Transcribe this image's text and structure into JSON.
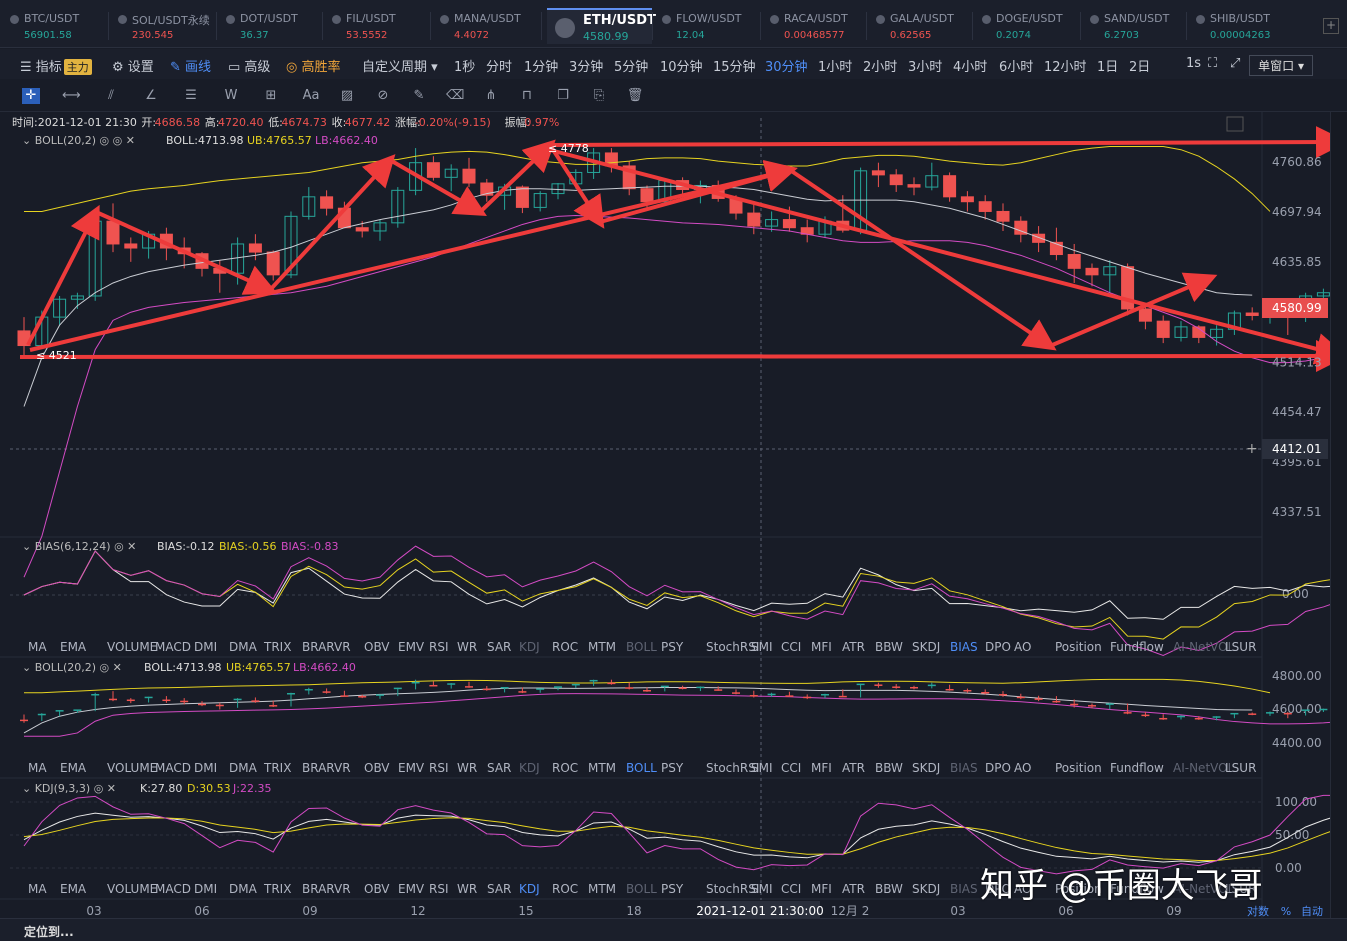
{
  "tabs": [
    {
      "name": "BTC/USDT",
      "price": "56901.58",
      "dir": "up"
    },
    {
      "name": "SOL/USDT永续",
      "price": "230.545",
      "dir": "dn"
    },
    {
      "name": "DOT/USDT",
      "price": "36.37",
      "dir": "up"
    },
    {
      "name": "FIL/USDT",
      "price": "53.5552",
      "dir": "dn"
    },
    {
      "name": "MANA/USDT",
      "price": "4.4072",
      "dir": "dn"
    },
    {
      "name": "ETH/USDT",
      "price": "4580.99",
      "dir": "up",
      "active": true
    },
    {
      "name": "FLOW/USDT",
      "price": "12.04",
      "dir": "up"
    },
    {
      "name": "RACA/USDT",
      "price": "0.00468577",
      "dir": "dn"
    },
    {
      "name": "GALA/USDT",
      "price": "0.62565",
      "dir": "dn"
    },
    {
      "name": "DOGE/USDT",
      "price": "0.2074",
      "dir": "up"
    },
    {
      "name": "SAND/USDT",
      "price": "6.2703",
      "dir": "up"
    },
    {
      "name": "SHIB/USDT",
      "price": "0.00004263",
      "dir": "up"
    }
  ],
  "toolbar": {
    "indicator": "指标",
    "main_badge": "主力",
    "settings": "设置",
    "draw": "画线",
    "advanced": "高级",
    "winrate": "高胜率",
    "custom_period": "自定义周期",
    "periods": [
      "1秒",
      "分时",
      "1分钟",
      "3分钟",
      "5分钟",
      "10分钟",
      "15分钟",
      "30分钟",
      "1小时",
      "2小时",
      "3小时",
      "4小时",
      "6小时",
      "12小时",
      "1日",
      "2日"
    ],
    "active_period": "30分钟",
    "interval": "1s",
    "single_window": "单窗口"
  },
  "colors": {
    "up": "#26a69a",
    "down": "#ef5350",
    "boll_mid": "#c9ccd3",
    "boll_ub": "#e6d320",
    "boll_lb": "#d34bc4",
    "blue": "#4f8ef7",
    "arrow": "#ee3b3b"
  },
  "info_line": {
    "time_label": "时间:",
    "time": "2021-12-01 21:30",
    "open_label": "开:",
    "open": "4686.58",
    "high_label": "高:",
    "high": "4720.40",
    "low_label": "低:",
    "low": "4674.73",
    "close_label": "收:",
    "close": "4677.42",
    "change_label": "涨幅:",
    "change": "-0.20%(-9.15)",
    "amp_label": "振幅:",
    "amp": "0.97%"
  },
  "boll_legend": {
    "name": "BOLL(20,2)",
    "mid": "BOLL:4713.98",
    "ub": "UB:4765.57",
    "lb": "LB:4662.40"
  },
  "bias_legend": {
    "name": "BIAS(6,12,24)",
    "b1": "BIAS:-0.12",
    "b2": "BIAS:-0.56",
    "b3": "BIAS:-0.83"
  },
  "kdj_legend": {
    "name": "KDJ(9,3,3)",
    "k": "K:27.80",
    "d": "D:30.53",
    "j": "J:22.35"
  },
  "indicator_tabs": [
    "MA",
    "EMA",
    "VOLUME",
    "MACD",
    "DMI",
    "DMA",
    "TRIX",
    "BRAR",
    "VR",
    "OBV",
    "EMV",
    "RSI",
    "WR",
    "SAR",
    "KDJ",
    "ROC",
    "MTM",
    "BOLL",
    "PSY",
    "StochRSI",
    "SMI",
    "CCI",
    "MFI",
    "ATR",
    "BBW",
    "SKDJ",
    "BIAS",
    "DPO",
    "AO",
    "Position",
    "Fundflow",
    "AI-NetVOL",
    "LSUR"
  ],
  "indicator_rows": [
    {
      "active": "BIAS",
      "dim": [
        "KDJ",
        "BOLL",
        "AI-NetVOL"
      ]
    },
    {
      "active": "BOLL",
      "dim": [
        "KDJ",
        "BIAS",
        "AI-NetVOL"
      ]
    },
    {
      "active": "KDJ",
      "dim": [
        "BOLL",
        "BIAS",
        "AI-NetVOL"
      ]
    }
  ],
  "main_axis": {
    "ticks": [
      "4760.86",
      "4697.94",
      "4635.85",
      "4514.13",
      "4454.47",
      "4395.61",
      "4337.51"
    ],
    "current_price": "4580.99",
    "crosshair_price": "4412.01",
    "ylim": [
      4290,
      4800
    ]
  },
  "panel2_axis": [
    "4800.00",
    "4600.00",
    "4400.00"
  ],
  "bias_axis": [
    "0.00"
  ],
  "kdj_axis": [
    "100.00",
    "50.00",
    "0.00"
  ],
  "x_axis": {
    "labels": [
      "03",
      "06",
      "09",
      "12",
      "15",
      "18",
      "12月 2",
      "03",
      "06",
      "09"
    ],
    "crosshair_time": "2021-12-01 21:30:00"
  },
  "annotations": {
    "max": "4778",
    "min": "4521"
  },
  "axis_mode": {
    "log": "对数",
    "pct": "%",
    "auto": "自动"
  },
  "footer": {
    "locate": "定位到..."
  },
  "watermark": "知乎 @币圈大飞哥",
  "chart_data": {
    "type": "candlestick",
    "title": "ETH/USDT",
    "interval": "30m",
    "ohlc": [
      [
        4553,
        4570,
        4521,
        4535
      ],
      [
        4535,
        4578,
        4532,
        4570
      ],
      [
        4570,
        4596,
        4560,
        4592
      ],
      [
        4592,
        4600,
        4580,
        4596
      ],
      [
        4596,
        4700,
        4590,
        4688
      ],
      [
        4688,
        4710,
        4650,
        4660
      ],
      [
        4660,
        4668,
        4638,
        4655
      ],
      [
        4655,
        4676,
        4642,
        4672
      ],
      [
        4672,
        4680,
        4640,
        4655
      ],
      [
        4655,
        4668,
        4630,
        4648
      ],
      [
        4648,
        4650,
        4620,
        4630
      ],
      [
        4630,
        4640,
        4600,
        4624
      ],
      [
        4624,
        4668,
        4610,
        4660
      ],
      [
        4660,
        4672,
        4640,
        4650
      ],
      [
        4650,
        4652,
        4615,
        4622
      ],
      [
        4622,
        4700,
        4618,
        4694
      ],
      [
        4694,
        4730,
        4690,
        4718
      ],
      [
        4718,
        4726,
        4695,
        4704
      ],
      [
        4704,
        4712,
        4680,
        4680
      ],
      [
        4680,
        4688,
        4668,
        4676
      ],
      [
        4676,
        4690,
        4664,
        4686
      ],
      [
        4686,
        4730,
        4680,
        4726
      ],
      [
        4726,
        4778,
        4720,
        4760
      ],
      [
        4760,
        4768,
        4738,
        4742
      ],
      [
        4742,
        4758,
        4725,
        4752
      ],
      [
        4752,
        4766,
        4730,
        4735
      ],
      [
        4735,
        4740,
        4712,
        4720
      ],
      [
        4720,
        4734,
        4702,
        4730
      ],
      [
        4730,
        4732,
        4698,
        4705
      ],
      [
        4705,
        4725,
        4700,
        4722
      ],
      [
        4722,
        4735,
        4715,
        4734
      ],
      [
        4734,
        4752,
        4728,
        4748
      ],
      [
        4748,
        4778,
        4740,
        4772
      ],
      [
        4772,
        4778,
        4748,
        4756
      ],
      [
        4756,
        4762,
        4720,
        4728
      ],
      [
        4728,
        4732,
        4705,
        4712
      ],
      [
        4712,
        4740,
        4708,
        4738
      ],
      [
        4738,
        4742,
        4720,
        4727
      ],
      [
        4727,
        4738,
        4710,
        4732
      ],
      [
        4732,
        4738,
        4712,
        4716
      ],
      [
        4716,
        4720,
        4690,
        4698
      ],
      [
        4698,
        4712,
        4672,
        4682
      ],
      [
        4682,
        4700,
        4675,
        4690
      ],
      [
        4690,
        4706,
        4675,
        4680
      ],
      [
        4680,
        4690,
        4662,
        4672
      ],
      [
        4672,
        4694,
        4668,
        4688
      ],
      [
        4688,
        4720,
        4674,
        4677
      ],
      [
        4677,
        4754,
        4672,
        4750
      ],
      [
        4750,
        4760,
        4730,
        4745
      ],
      [
        4745,
        4752,
        4724,
        4733
      ],
      [
        4733,
        4742,
        4720,
        4730
      ],
      [
        4730,
        4760,
        4726,
        4744
      ],
      [
        4744,
        4748,
        4712,
        4718
      ],
      [
        4718,
        4725,
        4700,
        4712
      ],
      [
        4712,
        4720,
        4690,
        4700
      ],
      [
        4700,
        4710,
        4676,
        4688
      ],
      [
        4688,
        4694,
        4662,
        4672
      ],
      [
        4672,
        4682,
        4650,
        4662
      ],
      [
        4662,
        4680,
        4640,
        4647
      ],
      [
        4647,
        4660,
        4612,
        4630
      ],
      [
        4630,
        4636,
        4608,
        4622
      ],
      [
        4622,
        4640,
        4600,
        4632
      ],
      [
        4632,
        4636,
        4572,
        4580
      ],
      [
        4580,
        4586,
        4555,
        4565
      ],
      [
        4565,
        4572,
        4538,
        4545
      ],
      [
        4545,
        4565,
        4540,
        4558
      ],
      [
        4558,
        4560,
        4538,
        4545
      ],
      [
        4545,
        4560,
        4535,
        4555
      ],
      [
        4555,
        4578,
        4548,
        4575
      ],
      [
        4575,
        4582,
        4566,
        4572
      ],
      [
        4572,
        4588,
        4562,
        4580
      ],
      [
        4580,
        4585,
        4548,
        4575
      ],
      [
        4575,
        4600,
        4564,
        4596
      ],
      [
        4596,
        4605,
        4585,
        4600
      ],
      [
        4600,
        4610,
        4590,
        4608
      ],
      [
        4608,
        4610,
        4575,
        4581
      ]
    ],
    "boll_ub": [
      4700,
      4700,
      4705,
      4710,
      4715,
      4720,
      4725,
      4728,
      4730,
      4732,
      4735,
      4738,
      4740,
      4742,
      4744,
      4746,
      4748,
      4752,
      4756,
      4760,
      4762,
      4764,
      4768,
      4771,
      4773,
      4774,
      4773,
      4770,
      4766,
      4762,
      4760,
      4758,
      4758,
      4760,
      4762,
      4765,
      4766,
      4766,
      4765,
      4762,
      4760,
      4758,
      4757,
      4756,
      4756,
      4760,
      4765,
      4767,
      4769,
      4769,
      4768,
      4765,
      4762,
      4760,
      4758,
      4757,
      4760,
      4765,
      4770,
      4775,
      4778,
      4780,
      4780,
      4780,
      4780,
      4776,
      4768,
      4755,
      4740,
      4722,
      4700
    ],
    "boll_mid": [
      4460,
      4520,
      4560,
      4584,
      4600,
      4612,
      4620,
      4626,
      4630,
      4634,
      4637,
      4640,
      4643,
      4646,
      4650,
      4656,
      4664,
      4672,
      4680,
      4685,
      4690,
      4694,
      4698,
      4702,
      4708,
      4716,
      4722,
      4726,
      4728,
      4728,
      4727,
      4726,
      4727,
      4728,
      4729,
      4730,
      4731,
      4731,
      4731,
      4730,
      4729,
      4727,
      4723,
      4719,
      4715,
      4713,
      4714,
      4714,
      4714,
      4714,
      4712,
      4708,
      4704,
      4698,
      4692,
      4684,
      4676,
      4668,
      4660,
      4652,
      4645,
      4638,
      4631,
      4624,
      4618,
      4612,
      4606,
      4600,
      4598,
      4597
    ],
    "boll_lb": [
      4250,
      4300,
      4380,
      4460,
      4530,
      4566,
      4576,
      4582,
      4585,
      4588,
      4590,
      4592,
      4594,
      4596,
      4598,
      4600,
      4604,
      4608,
      4614,
      4620,
      4626,
      4632,
      4638,
      4644,
      4652,
      4660,
      4668,
      4676,
      4684,
      4690,
      4694,
      4695,
      4694,
      4693,
      4692,
      4690,
      4688,
      4686,
      4685,
      4684,
      4682,
      4680,
      4678,
      4676,
      4672,
      4668,
      4664,
      4662,
      4662,
      4663,
      4664,
      4664,
      4664,
      4662,
      4658,
      4652,
      4646,
      4638,
      4630,
      4620,
      4610,
      4600,
      4592,
      4584,
      4576,
      4568,
      4556,
      4540,
      4528,
      4520,
      4514,
      4514,
      4516,
      4520,
      4528
    ]
  }
}
